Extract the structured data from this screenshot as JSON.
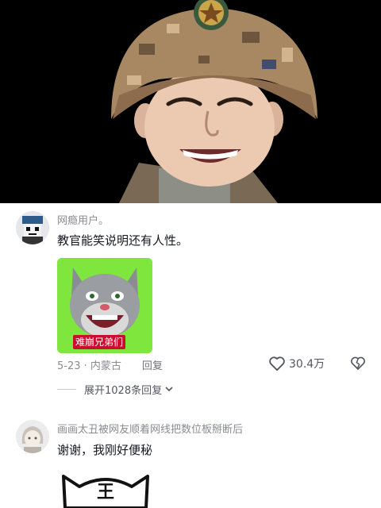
{
  "hero": {
    "photo_icon": "soldier-smiling-photo"
  },
  "comment1": {
    "username": "网瘾用户。",
    "text": "教官能笑说明还有人性。",
    "sticker": {
      "icon": "talking-tom-cat-laughing-sticker",
      "caption": "难崩兄弟们",
      "background": "#7ee63c",
      "caption_color": "#c8102e"
    },
    "date_location": "5-23 · 内蒙古",
    "reply_label": "回复",
    "like_count": "30.4万",
    "expand_label": "展开1028条回复"
  },
  "comment2": {
    "username": "画画太丑被网友顺着网线把数位板掰断后",
    "text": "谢谢，我刚好便秘",
    "sticker": {
      "icon": "cartoon-tiger-sticker",
      "visible_text": "王"
    }
  },
  "colors": {
    "primary_text": "#161823",
    "secondary_text": "#8a8b91",
    "background": "#ffffff"
  }
}
